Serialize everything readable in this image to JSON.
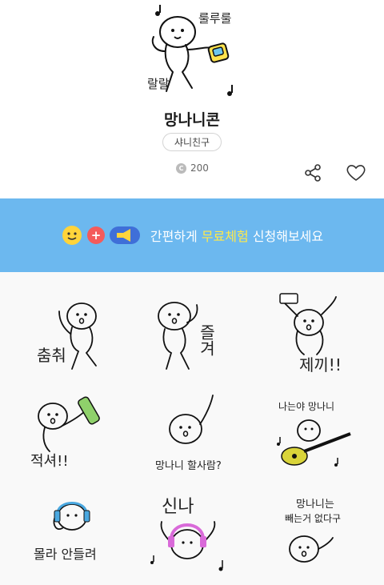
{
  "product": {
    "hero_text_1": "룰루룰",
    "hero_text_2": "랄랄",
    "title": "망나니콘",
    "author": "샤니친구",
    "price": "200",
    "coin_glyph": "C"
  },
  "banner": {
    "text_before": "간편하게 ",
    "text_highlight": "무료체험",
    "text_after": " 신청해보세요",
    "plus_glyph": "+",
    "background": "#6cb8ef",
    "highlight_color": "#ffe94a"
  },
  "stickers": [
    {
      "text": "춤춰"
    },
    {
      "text": "즐겨"
    },
    {
      "text": "제끼!!"
    },
    {
      "text": "적셔!!"
    },
    {
      "text": "망나니 할사람?"
    },
    {
      "text": "나는야 망나니"
    },
    {
      "text": "몰라 안들려"
    },
    {
      "text": "신나"
    },
    {
      "text": "망나니는",
      "text2": "빼는거 없다구"
    }
  ],
  "icons": {
    "share": "share-icon",
    "like": "heart-icon",
    "emoji": "smiley-icon",
    "megaphone": "megaphone-icon"
  }
}
